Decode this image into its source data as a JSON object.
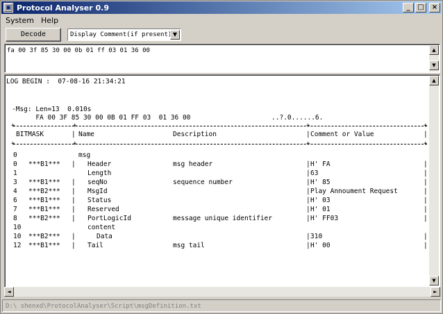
{
  "window": {
    "title": "Protocol Analyser 0.9"
  },
  "window_controls": {
    "minimize": "_",
    "maximize": "□",
    "close": "×"
  },
  "menu": [
    "System",
    "Help"
  ],
  "toolbar": {
    "decode_label": "Decode",
    "display_value": "Display  Comment(if present)"
  },
  "hex_input": {
    "value": "fa 00 3f 85 30 00 0b 01 ff 03 01 36 00"
  },
  "output": {
    "log_begin": "LOG BEGIN :  07-08-16 21:34:21",
    "msg_summary": "-Msg: Len=13  0.010s",
    "hex_line": "      FA 00 3F 85 30 00 0B 01 FF 03  01 36 00",
    "ascii_line": "..?.0......6.",
    "headers": {
      "bitmask": "BITMASK",
      "name": "Name",
      "description": "Description",
      "comment": "Comment or Value"
    },
    "rows": [
      {
        "level": "0",
        "bitmask": "",
        "name": "msg",
        "indent": 0,
        "description": "",
        "value": "",
        "has_value": false
      },
      {
        "level": "0",
        "bitmask": "***B1***",
        "name": "Header",
        "indent": 1,
        "description": "msg header",
        "value": "H' FA",
        "has_value": true
      },
      {
        "level": "1",
        "bitmask": "",
        "name": "Length",
        "indent": 1,
        "description": "",
        "value": "63",
        "has_value": true
      },
      {
        "level": "3",
        "bitmask": "***B1***",
        "name": "seqNo",
        "indent": 1,
        "description": "sequence number",
        "value": "H' 85",
        "has_value": true
      },
      {
        "level": "4",
        "bitmask": "***B2***",
        "name": "MsgId",
        "indent": 1,
        "description": "",
        "value": "Play Annoument Request",
        "has_value": true
      },
      {
        "level": "6",
        "bitmask": "***B1***",
        "name": "Status",
        "indent": 1,
        "description": "",
        "value": "H' 03",
        "has_value": true
      },
      {
        "level": "7",
        "bitmask": "***B1***",
        "name": "Reserved",
        "indent": 1,
        "description": "",
        "value": "H' 01",
        "has_value": true
      },
      {
        "level": "8",
        "bitmask": "***B2***",
        "name": "PortLogicId",
        "indent": 1,
        "description": "message unique identifier",
        "value": "H' FF03",
        "has_value": true
      },
      {
        "level": "10",
        "bitmask": "",
        "name": "content",
        "indent": 1,
        "description": "",
        "value": "",
        "has_value": false
      },
      {
        "level": "10",
        "bitmask": "***B2***",
        "name": "Data",
        "indent": 2,
        "description": "",
        "value": "310",
        "has_value": true
      },
      {
        "level": "12",
        "bitmask": "***B1***",
        "name": "Tail",
        "indent": 1,
        "description": "msg tail",
        "value": "H' 00",
        "has_value": true
      }
    ]
  },
  "statusbar": {
    "path": "D:\\ shenxd\\ProtocolAnalyser\\Script\\msgDefinition.txt"
  }
}
